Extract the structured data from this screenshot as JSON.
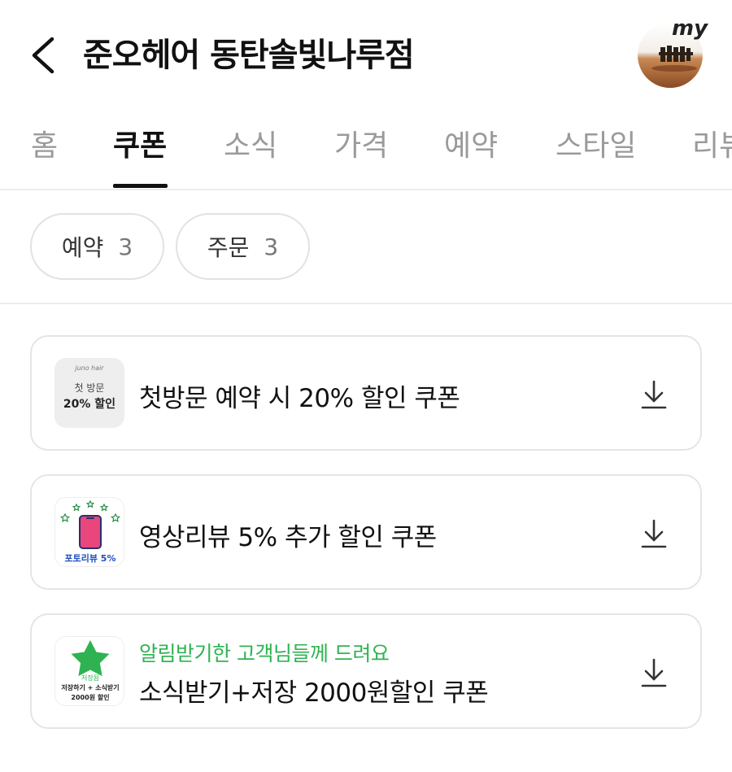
{
  "header": {
    "title": "준오헤어 동탄솔빛나루점",
    "avatar_label": "my"
  },
  "tabs": [
    {
      "label": "홈",
      "active": false
    },
    {
      "label": "쿠폰",
      "active": true
    },
    {
      "label": "소식",
      "active": false
    },
    {
      "label": "가격",
      "active": false
    },
    {
      "label": "예약",
      "active": false
    },
    {
      "label": "스타일",
      "active": false
    },
    {
      "label": "리뷰",
      "active": false
    }
  ],
  "filters": [
    {
      "label": "예약",
      "count": "3"
    },
    {
      "label": "주문",
      "count": "3"
    }
  ],
  "coupons": [
    {
      "title": "첫방문 예약 시 20% 할인 쿠폰",
      "subtitle": "",
      "thumb": {
        "brand": "juno hair",
        "line1": "첫 방문",
        "line2": "20% 할인"
      }
    },
    {
      "title": "영상리뷰 5% 추가 할인 쿠폰",
      "subtitle": "",
      "thumb": {
        "caption": "포토리뷰 5%"
      }
    },
    {
      "title": "소식받기+저장 2000원할인 쿠폰",
      "subtitle": "알림받기한 고객님들께 드려요",
      "thumb": {
        "line1": "저장됨",
        "line2": "저장하기 + 소식받기",
        "line3": "2000원 할인"
      }
    }
  ],
  "colors": {
    "accent_green": "#2fb352",
    "tab_inactive": "#9a9a9a",
    "border": "#e5e5e5",
    "review_pink": "#e8467c",
    "review_caption": "#1f4fbf"
  },
  "icons": {
    "back": "chevron-left-icon",
    "download": "download-icon",
    "star": "star-icon"
  }
}
